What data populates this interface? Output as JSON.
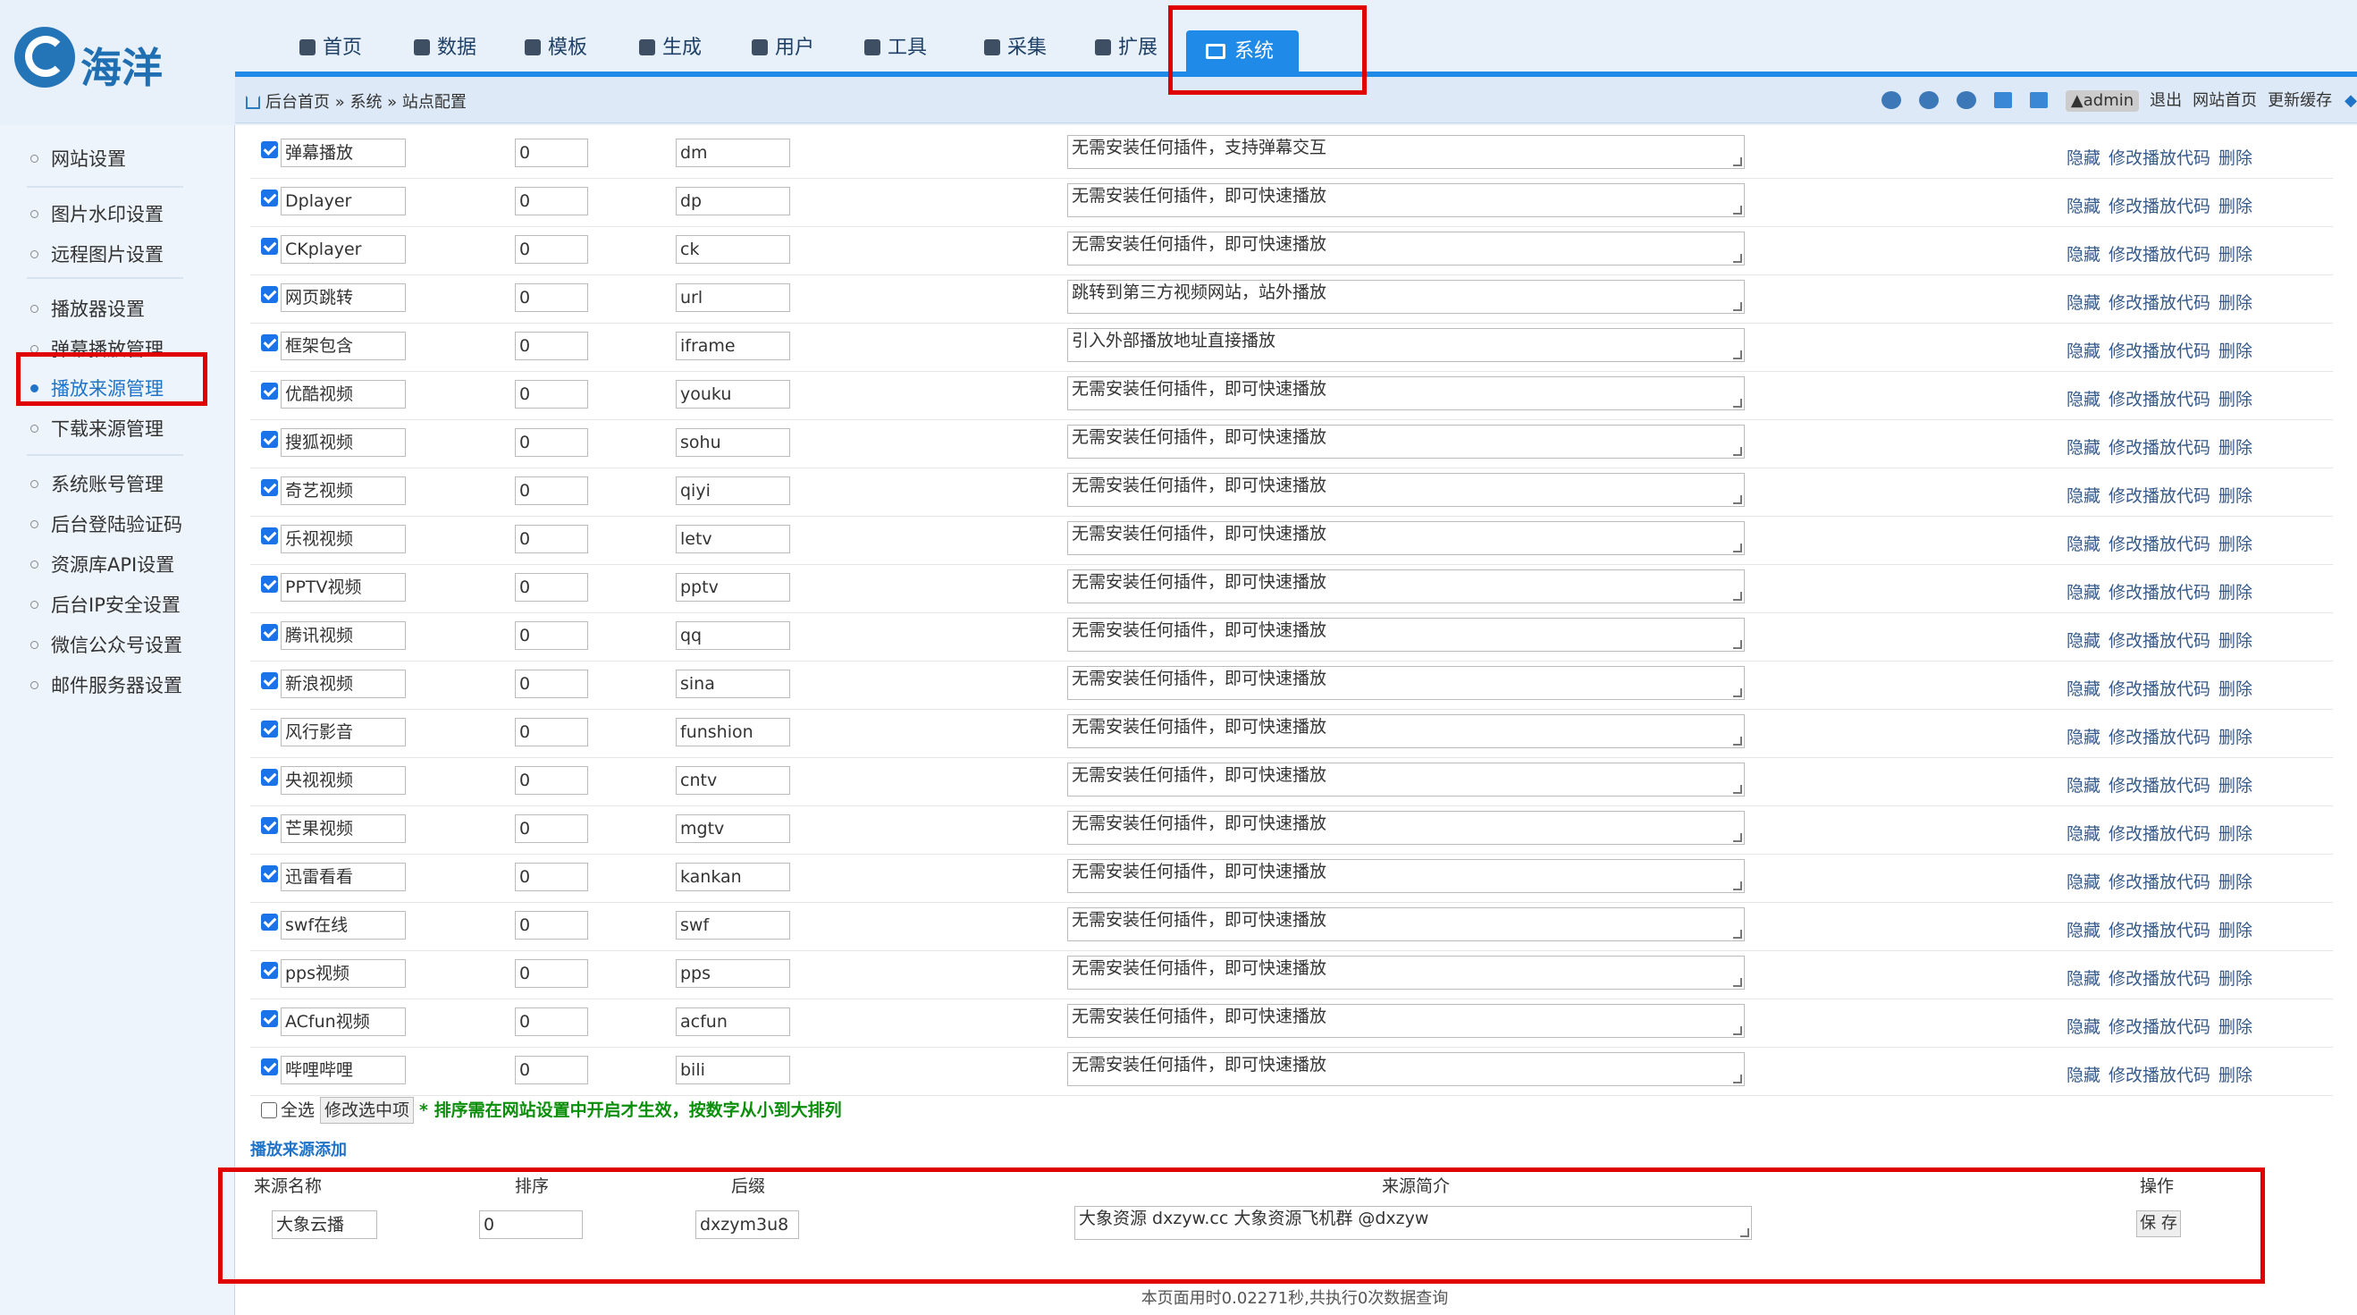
{
  "logo": {
    "text": "海洋"
  },
  "nav": {
    "items": [
      {
        "label": "首页",
        "icon": "home-icon"
      },
      {
        "label": "数据",
        "icon": "list-icon"
      },
      {
        "label": "模板",
        "icon": "palette-icon"
      },
      {
        "label": "生成",
        "icon": "generate-icon"
      },
      {
        "label": "用户",
        "icon": "user-icon"
      },
      {
        "label": "工具",
        "icon": "tools-icon"
      },
      {
        "label": "采集",
        "icon": "collect-icon"
      },
      {
        "label": "扩展",
        "icon": "extend-icon"
      }
    ],
    "active": {
      "label": "系统",
      "icon": "monitor-icon"
    }
  },
  "breadcrumb": {
    "text": "后台首页 » 系统 » 站点配置"
  },
  "toolbar": {
    "user": "admin",
    "logout": "退出",
    "site_home": "网站首页",
    "clear_cache": "更新缓存"
  },
  "sidebar": {
    "items": [
      {
        "label": "网站设置"
      },
      {
        "label": "图片水印设置"
      },
      {
        "label": "远程图片设置"
      },
      {
        "label": "播放器设置"
      },
      {
        "label": "弹幕播放管理"
      },
      {
        "label": "播放来源管理"
      },
      {
        "label": "下载来源管理"
      },
      {
        "label": "系统账号管理"
      },
      {
        "label": "后台登陆验证码"
      },
      {
        "label": "资源库API设置"
      },
      {
        "label": "后台IP安全设置"
      },
      {
        "label": "微信公众号设置"
      },
      {
        "label": "邮件服务器设置"
      }
    ]
  },
  "ops": {
    "hide": "隐藏",
    "edit": "修改播放代码",
    "delete": "删除"
  },
  "rows": [
    {
      "name": "弹幕播放",
      "sort": "0",
      "suffix": "dm",
      "desc": "无需安装任何插件，支持弹幕交互"
    },
    {
      "name": "Dplayer",
      "sort": "0",
      "suffix": "dp",
      "desc": "无需安装任何插件，即可快速播放"
    },
    {
      "name": "CKplayer",
      "sort": "0",
      "suffix": "ck",
      "desc": "无需安装任何插件，即可快速播放"
    },
    {
      "name": "网页跳转",
      "sort": "0",
      "suffix": "url",
      "desc": "跳转到第三方视频网站，站外播放"
    },
    {
      "name": "框架包含",
      "sort": "0",
      "suffix": "iframe",
      "desc": "引入外部播放地址直接播放"
    },
    {
      "name": "优酷视频",
      "sort": "0",
      "suffix": "youku",
      "desc": "无需安装任何插件，即可快速播放"
    },
    {
      "name": "搜狐视频",
      "sort": "0",
      "suffix": "sohu",
      "desc": "无需安装任何插件，即可快速播放"
    },
    {
      "name": "奇艺视频",
      "sort": "0",
      "suffix": "qiyi",
      "desc": "无需安装任何插件，即可快速播放"
    },
    {
      "name": "乐视视频",
      "sort": "0",
      "suffix": "letv",
      "desc": "无需安装任何插件，即可快速播放"
    },
    {
      "name": "PPTV视频",
      "sort": "0",
      "suffix": "pptv",
      "desc": "无需安装任何插件，即可快速播放"
    },
    {
      "name": "腾讯视频",
      "sort": "0",
      "suffix": "qq",
      "desc": "无需安装任何插件，即可快速播放"
    },
    {
      "name": "新浪视频",
      "sort": "0",
      "suffix": "sina",
      "desc": "无需安装任何插件，即可快速播放"
    },
    {
      "name": "风行影音",
      "sort": "0",
      "suffix": "funshion",
      "desc": "无需安装任何插件，即可快速播放"
    },
    {
      "name": "央视视频",
      "sort": "0",
      "suffix": "cntv",
      "desc": "无需安装任何插件，即可快速播放"
    },
    {
      "name": "芒果视频",
      "sort": "0",
      "suffix": "mgtv",
      "desc": "无需安装任何插件，即可快速播放"
    },
    {
      "name": "迅雷看看",
      "sort": "0",
      "suffix": "kankan",
      "desc": "无需安装任何插件，即可快速播放"
    },
    {
      "name": "swf在线",
      "sort": "0",
      "suffix": "swf",
      "desc": "无需安装任何插件，即可快速播放"
    },
    {
      "name": "pps视频",
      "sort": "0",
      "suffix": "pps",
      "desc": "无需安装任何插件，即可快速播放"
    },
    {
      "name": "ACfun视频",
      "sort": "0",
      "suffix": "acfun",
      "desc": "无需安装任何插件，即可快速播放"
    },
    {
      "name": "哔哩哔哩",
      "sort": "0",
      "suffix": "bili",
      "desc": "无需安装任何插件，即可快速播放"
    }
  ],
  "footer_actions": {
    "select_all": "全选",
    "modify_selected": "修改选中项",
    "note": "* 排序需在网站设置中开启才生效，按数字从小到大排列"
  },
  "add_section": {
    "title": "播放来源添加",
    "headers": {
      "name": "来源名称",
      "sort": "排序",
      "suffix": "后缀",
      "desc": "来源简介",
      "action": "操作"
    },
    "values": {
      "name": "大象云播",
      "sort": "0",
      "suffix": "dxzym3u8",
      "desc": "大象资源 dxzyw.cc 大象资源飞机群 @dxzyw"
    },
    "save": "保 存"
  },
  "page_footer": {
    "text": "本页面用时0.02271秒,共执行0次数据查询"
  }
}
